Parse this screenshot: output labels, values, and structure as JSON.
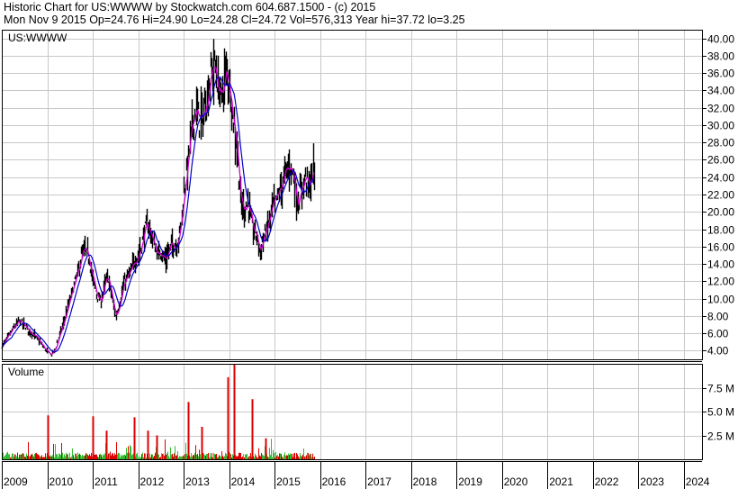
{
  "header": {
    "line1": "Historic Chart for US:WWWW by Stockwatch.com 604.687.1500 - (c) 2015",
    "line2": "Mon Nov  9 2015   Op=24.76   Hi=24.90   Lo=24.28   Cl=24.72   Vol=576,313   Year hi=37.72   lo=3.25"
  },
  "chart_data": {
    "type": "line",
    "price_panel_label": "US:WWWW",
    "volume_panel_label": "Volume",
    "price_ylim": [
      3,
      41
    ],
    "price_ticks": [
      "40.00",
      "38.00",
      "36.00",
      "34.00",
      "32.00",
      "30.00",
      "28.00",
      "26.00",
      "24.00",
      "22.00",
      "20.00",
      "18.00",
      "16.00",
      "14.00",
      "12.00",
      "10.00",
      "8.00",
      "6.00",
      "4.00"
    ],
    "volume_ylim": [
      0,
      10
    ],
    "volume_ticks": [
      "7.5 M",
      "5.0 M",
      "2.5 M"
    ],
    "x_ticks": [
      "2009",
      "2010",
      "2011",
      "2012",
      "2013",
      "2014",
      "2015",
      "2016",
      "2017",
      "2018",
      "2019",
      "2020",
      "2021",
      "2022",
      "2023",
      "2024"
    ],
    "x_range": [
      2009.0,
      2024.4
    ],
    "colors": {
      "price": "#000000",
      "ma_short": "#cc00cc",
      "ma_long": "#0000cc",
      "vol_up": "#33bb33",
      "vol_down": "#dd0000",
      "grid": "#c8c8c8"
    },
    "series": [
      {
        "kind": "price",
        "x": [
          2009.0,
          2009.12,
          2009.25,
          2009.38,
          2009.5,
          2009.62,
          2009.75,
          2009.88,
          2010.0,
          2010.08,
          2010.17,
          2010.25,
          2010.33,
          2010.42,
          2010.5,
          2010.58,
          2010.67,
          2010.75,
          2010.83,
          2010.92,
          2011.0,
          2011.08,
          2011.17,
          2011.25,
          2011.33,
          2011.42,
          2011.5,
          2011.58,
          2011.67,
          2011.75,
          2011.83,
          2011.92,
          2012.0,
          2012.08,
          2012.17,
          2012.25,
          2012.33,
          2012.42,
          2012.5,
          2012.58,
          2012.67,
          2012.75,
          2012.83,
          2012.92,
          2013.0,
          2013.08,
          2013.17,
          2013.25,
          2013.33,
          2013.42,
          2013.5,
          2013.58,
          2013.67,
          2013.75,
          2013.83,
          2013.92,
          2014.0,
          2014.08,
          2014.17,
          2014.25,
          2014.33,
          2014.42,
          2014.5,
          2014.58,
          2014.67,
          2014.75,
          2014.83,
          2014.92,
          2015.0,
          2015.08,
          2015.17,
          2015.25,
          2015.33,
          2015.42,
          2015.5,
          2015.58,
          2015.67,
          2015.75,
          2015.86
        ],
        "values": [
          4.5,
          5.5,
          6.6,
          7.4,
          6.8,
          6.2,
          5.5,
          4.6,
          3.8,
          3.5,
          4.2,
          5.6,
          6.8,
          8.5,
          10.0,
          11.5,
          13.0,
          15.0,
          15.5,
          14.5,
          12.0,
          10.5,
          9.5,
          11.5,
          12.5,
          10.0,
          7.8,
          9.5,
          11.5,
          12.5,
          13.0,
          14.5,
          15.0,
          16.5,
          18.5,
          18.0,
          16.5,
          15.0,
          15.5,
          14.5,
          15.5,
          16.5,
          16.0,
          18.0,
          22.0,
          25.5,
          29.5,
          32.0,
          30.5,
          31.0,
          33.0,
          35.5,
          37.0,
          34.5,
          33.0,
          36.0,
          35.0,
          31.0,
          27.5,
          21.0,
          20.5,
          21.0,
          18.0,
          17.5,
          15.5,
          17.0,
          18.0,
          20.0,
          21.0,
          22.0,
          23.5,
          24.5,
          25.5,
          24.0,
          21.0,
          22.5,
          24.0,
          23.0,
          24.72
        ]
      },
      {
        "kind": "ma_short",
        "name": ""
      },
      {
        "kind": "ma_long",
        "name": ""
      }
    ],
    "volume_spikes": [
      {
        "x": 2010.0,
        "value": 4.6
      },
      {
        "x": 2011.0,
        "value": 4.5
      },
      {
        "x": 2011.3,
        "value": 3.0
      },
      {
        "x": 2011.9,
        "value": 4.4
      },
      {
        "x": 2012.2,
        "value": 3.0
      },
      {
        "x": 2012.4,
        "value": 2.5
      },
      {
        "x": 2013.1,
        "value": 6.0
      },
      {
        "x": 2013.4,
        "value": 3.4
      },
      {
        "x": 2013.96,
        "value": 8.6
      },
      {
        "x": 2014.1,
        "value": 10.0
      },
      {
        "x": 2014.5,
        "value": 6.3
      },
      {
        "x": 2014.8,
        "value": 2.2
      }
    ]
  }
}
